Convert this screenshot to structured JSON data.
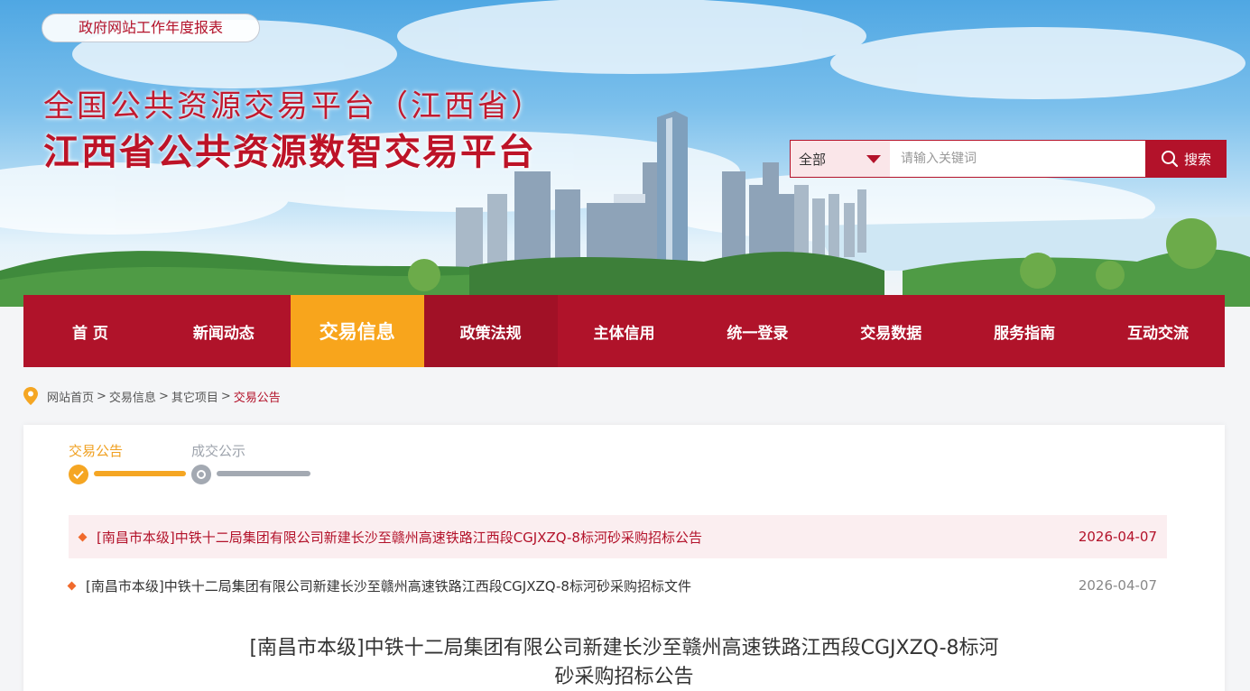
{
  "header": {
    "report_link": "政府网站工作年度报表",
    "title_line1": "全国公共资源交易平台（江西省）",
    "title_line2": "江西省公共资源数智交易平台"
  },
  "search": {
    "category": "全部",
    "placeholder": "请输入关键词",
    "button": "搜索"
  },
  "nav": {
    "items": [
      "首 页",
      "新闻动态",
      "交易信息",
      "政策法规",
      "主体信用",
      "统一登录",
      "交易数据",
      "服务指南",
      "互动交流"
    ],
    "active_index": 2
  },
  "breadcrumb": {
    "home": "网站首页",
    "level1": "交易信息",
    "level2": "其它项目",
    "current": "交易公告"
  },
  "steps": {
    "step1": "交易公告",
    "step2": "成交公示"
  },
  "list": [
    {
      "title": "[南昌市本级]中铁十二局集团有限公司新建长沙至赣州高速铁路江西段CGJXZQ-8标河砂采购招标公告",
      "date": "2026-04-07"
    },
    {
      "title": "[南昌市本级]中铁十二局集团有限公司新建长沙至赣州高速铁路江西段CGJXZQ-8标河砂采购招标文件",
      "date": "2026-04-07"
    }
  ],
  "article": {
    "title_line1": "[南昌市本级]中铁十二局集团有限公司新建长沙至赣州高速铁路江西段CGJXZQ-8标河",
    "title_line2": "砂采购招标公告"
  },
  "colors": {
    "brand_red": "#b0132a",
    "accent_orange": "#f8a51c",
    "inactive_gray": "#a3a9b2"
  }
}
